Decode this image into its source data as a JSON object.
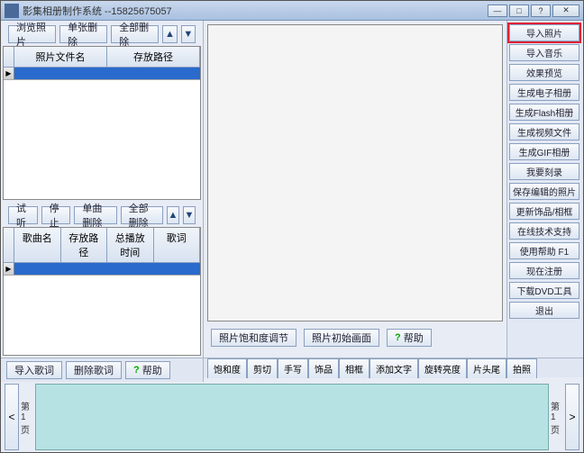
{
  "title": "影集相册制作系统 --15825675057",
  "window_controls": {
    "min": "—",
    "max": "□",
    "help": "?",
    "close": "✕"
  },
  "top_toolbar": {
    "browse": "浏览照片",
    "del_one": "单张删除",
    "del_all": "全部删除"
  },
  "photo_grid": {
    "col1": "照片文件名",
    "col2": "存放路径"
  },
  "song_toolbar": {
    "try": "试听",
    "stop": "停止",
    "del_one": "单曲删除",
    "del_all": "全部删除"
  },
  "song_grid": {
    "c1": "歌曲名",
    "c2": "存放路径",
    "c3": "总播放时间",
    "c4": "歌词"
  },
  "center_toolbar": {
    "sat": "照片饱和度调节",
    "init": "照片初始画面",
    "help": "帮助"
  },
  "right": {
    "import_photo": "导入照片",
    "import_music": "导入音乐",
    "preview": "效果预览",
    "gen_ebook": "生成电子相册",
    "gen_flash": "生成Flash相册",
    "gen_video": "生成视频文件",
    "gen_gif": "生成GIF相册",
    "burn": "我要刻录",
    "save_edit": "保存编辑的照片",
    "update_deco": "更新饰品/相框",
    "online_support": "在线技术支持",
    "use_help": "使用帮助  F1",
    "register": "现在注册",
    "dvd_tool": "下载DVD工具",
    "exit": "退出"
  },
  "bottom_toolbar": {
    "import_lyric": "导入歌词",
    "del_lyric": "删除歌词",
    "help": "帮助"
  },
  "tabs": {
    "t1": "饱和度",
    "t2": "剪切",
    "t3": "手写",
    "t4": "饰品",
    "t5": "相框",
    "t6": "添加文字",
    "t7": "旋转亮度",
    "t8": "片头尾",
    "t9": "拍照"
  },
  "timeline": {
    "page_label": "第1页",
    "prev": "<",
    "next": ">"
  }
}
